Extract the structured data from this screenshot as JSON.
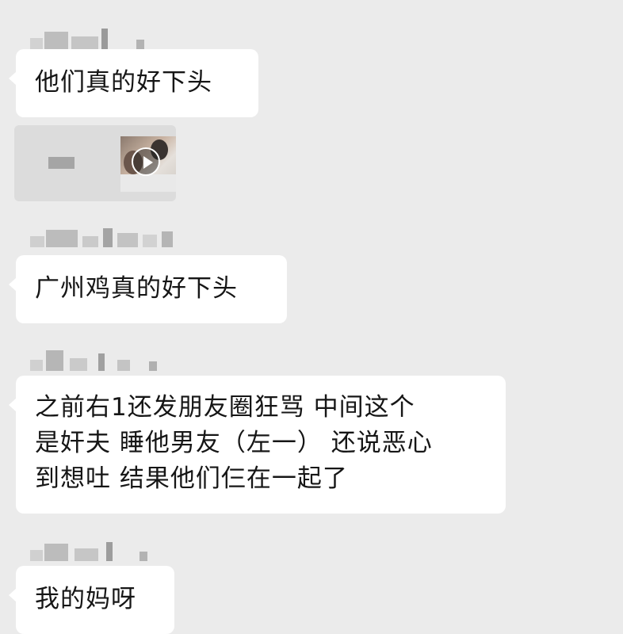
{
  "messages": [
    {
      "text": "他们真的好下头"
    },
    {
      "type": "video"
    },
    {
      "text": "广州鸡真的好下头"
    },
    {
      "text": "之前右1还发朋友圈狂骂 中间这个\n是奸夫 睡他男友（左一） 还说恶心\n到想吐  结果他们仨在一起了"
    },
    {
      "text": "我的妈呀"
    }
  ],
  "colors": {
    "background": "#ebebeb",
    "bubble": "#ffffff",
    "text": "#161616",
    "blur": "#a5a5a5"
  }
}
